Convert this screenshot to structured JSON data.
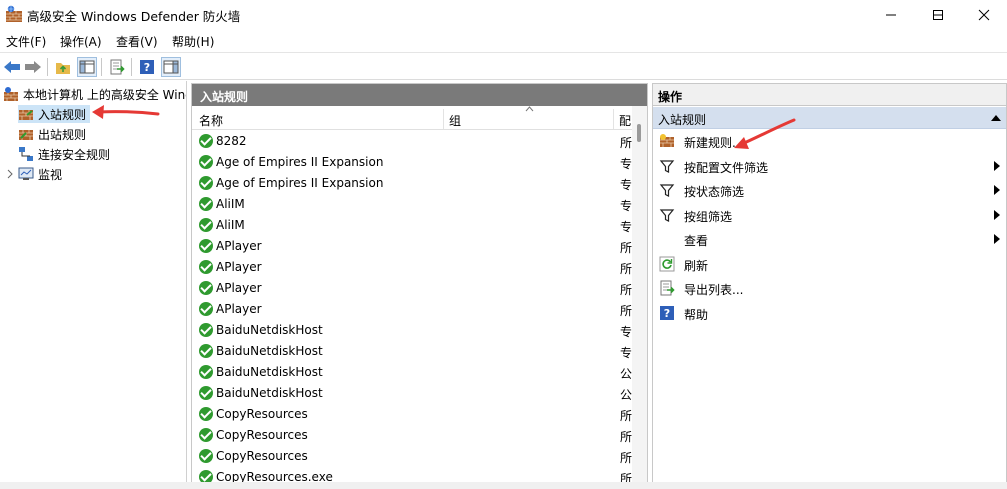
{
  "window": {
    "title": "高级安全 Windows Defender 防火墙"
  },
  "menu": [
    {
      "label": "文件(F)"
    },
    {
      "label": "操作(A)"
    },
    {
      "label": "查看(V)"
    },
    {
      "label": "帮助(H)"
    }
  ],
  "tree": {
    "root": "本地计算机 上的高级安全 Windows",
    "items": [
      {
        "label": "入站规则",
        "selected": true
      },
      {
        "label": "出站规则"
      },
      {
        "label": "连接安全规则"
      },
      {
        "label": "监视"
      }
    ]
  },
  "rules_pane": {
    "title": "入站规则",
    "columns": {
      "name": "名称",
      "group": "组",
      "profile": "配"
    },
    "rows": [
      {
        "name": "8282",
        "profile": "所"
      },
      {
        "name": "Age of Empires II Expansion",
        "profile": "专"
      },
      {
        "name": "Age of Empires II Expansion",
        "profile": "专"
      },
      {
        "name": "AliIM",
        "profile": "专"
      },
      {
        "name": "AliIM",
        "profile": "专"
      },
      {
        "name": "APlayer",
        "profile": "所"
      },
      {
        "name": "APlayer",
        "profile": "所"
      },
      {
        "name": "APlayer",
        "profile": "所"
      },
      {
        "name": "APlayer",
        "profile": "所"
      },
      {
        "name": "BaiduNetdiskHost",
        "profile": "专"
      },
      {
        "name": "BaiduNetdiskHost",
        "profile": "专"
      },
      {
        "name": "BaiduNetdiskHost",
        "profile": "公"
      },
      {
        "name": "BaiduNetdiskHost",
        "profile": "公"
      },
      {
        "name": "CopyResources",
        "profile": "所"
      },
      {
        "name": "CopyResources",
        "profile": "所"
      },
      {
        "name": "CopyResources",
        "profile": "所"
      },
      {
        "name": "CopyResources.exe",
        "profile": "所"
      }
    ]
  },
  "actions_pane": {
    "title": "操作",
    "section": "入站规则",
    "items": [
      {
        "label": "新建规则...",
        "icon": "new-rule-icon",
        "submenu": false
      },
      {
        "label": "按配置文件筛选",
        "icon": "filter-icon",
        "submenu": true
      },
      {
        "label": "按状态筛选",
        "icon": "filter-icon",
        "submenu": true
      },
      {
        "label": "按组筛选",
        "icon": "filter-icon",
        "submenu": true
      },
      {
        "label": "查看",
        "icon": "",
        "submenu": true
      },
      {
        "label": "刷新",
        "icon": "refresh-icon",
        "submenu": false
      },
      {
        "label": "导出列表...",
        "icon": "export-icon",
        "submenu": false
      },
      {
        "label": "帮助",
        "icon": "help-icon",
        "submenu": false
      }
    ]
  },
  "colors": {
    "accent_arrow": "#e53935",
    "header_gray": "#7a7a7a",
    "section_blue": "#d4dfee",
    "enabled_green": "#2f9a2f"
  }
}
